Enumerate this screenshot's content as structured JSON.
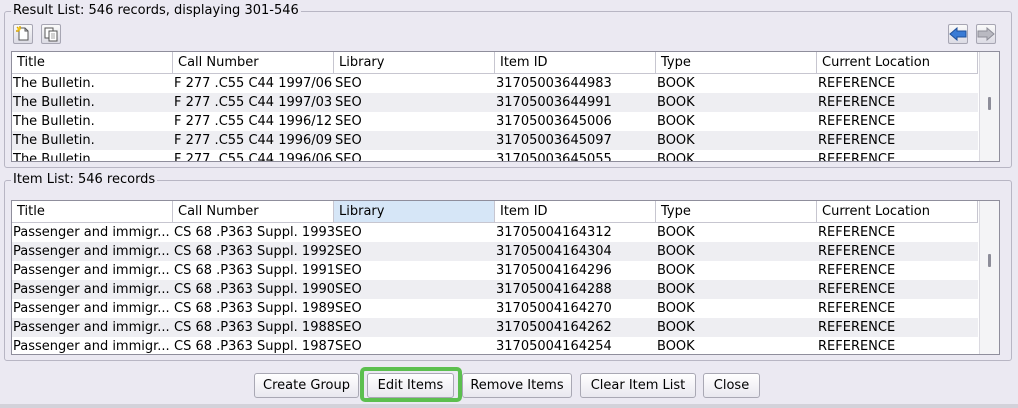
{
  "result_list": {
    "title": "Result List: 546 records, displaying 301-546",
    "columns": [
      "Title",
      "Call Number",
      "Library",
      "Item ID",
      "Type",
      "Current Location"
    ],
    "rows": [
      [
        "The Bulletin.",
        "F 277 .C55 C44 1997/06",
        "SEO",
        "31705003644983",
        "BOOK",
        "REFERENCE"
      ],
      [
        "The Bulletin.",
        "F 277 .C55 C44 1997/03",
        "SEO",
        "31705003644991",
        "BOOK",
        "REFERENCE"
      ],
      [
        "The Bulletin.",
        "F 277 .C55 C44 1996/12",
        "SEO",
        "31705003645006",
        "BOOK",
        "REFERENCE"
      ],
      [
        "The Bulletin.",
        "F 277 .C55 C44 1996/09",
        "SEO",
        "31705003645097",
        "BOOK",
        "REFERENCE"
      ],
      [
        "The Bulletin.",
        "F 277 .C55 C44 1996/06",
        "SEO",
        "31705003645055",
        "BOOK",
        "REFERENCE"
      ]
    ]
  },
  "item_list": {
    "title": "Item List: 546 records",
    "columns": [
      "Title",
      "Call Number",
      "Library",
      "Item ID",
      "Type",
      "Current Location"
    ],
    "selected_column": 2,
    "rows": [
      [
        "Passenger and immigr...",
        "CS 68 .P363 Suppl. 1993",
        "SEO",
        "31705004164312",
        "BOOK",
        "REFERENCE"
      ],
      [
        "Passenger and immigr...",
        "CS 68 .P363 Suppl. 1992",
        "SEO",
        "31705004164304",
        "BOOK",
        "REFERENCE"
      ],
      [
        "Passenger and immigr...",
        "CS 68 .P363 Suppl. 1991",
        "SEO",
        "31705004164296",
        "BOOK",
        "REFERENCE"
      ],
      [
        "Passenger and immigr...",
        "CS 68 .P363 Suppl. 1990",
        "SEO",
        "31705004164288",
        "BOOK",
        "REFERENCE"
      ],
      [
        "Passenger and immigr...",
        "CS 68 .P363 Suppl. 1989",
        "SEO",
        "31705004164270",
        "BOOK",
        "REFERENCE"
      ],
      [
        "Passenger and immigr...",
        "CS 68 .P363 Suppl. 1988",
        "SEO",
        "31705004164262",
        "BOOK",
        "REFERENCE"
      ],
      [
        "Passenger and immigr...",
        "CS 68 .P363 Suppl. 1987",
        "SEO",
        "31705004164254",
        "BOOK",
        "REFERENCE"
      ]
    ]
  },
  "toolbar": {
    "icons": [
      "new-document-icon",
      "copy-document-icon",
      "arrow-left-icon",
      "arrow-right-icon"
    ]
  },
  "buttons": {
    "create_group": "Create Group",
    "edit_items": "Edit Items",
    "remove_items": "Remove Items",
    "clear_item_list": "Clear Item List",
    "close": "Close"
  },
  "colors": {
    "highlight": "#5cbf4f",
    "selected_header": "#d6e6f7",
    "arrow_blue": "#3a7bd5"
  }
}
